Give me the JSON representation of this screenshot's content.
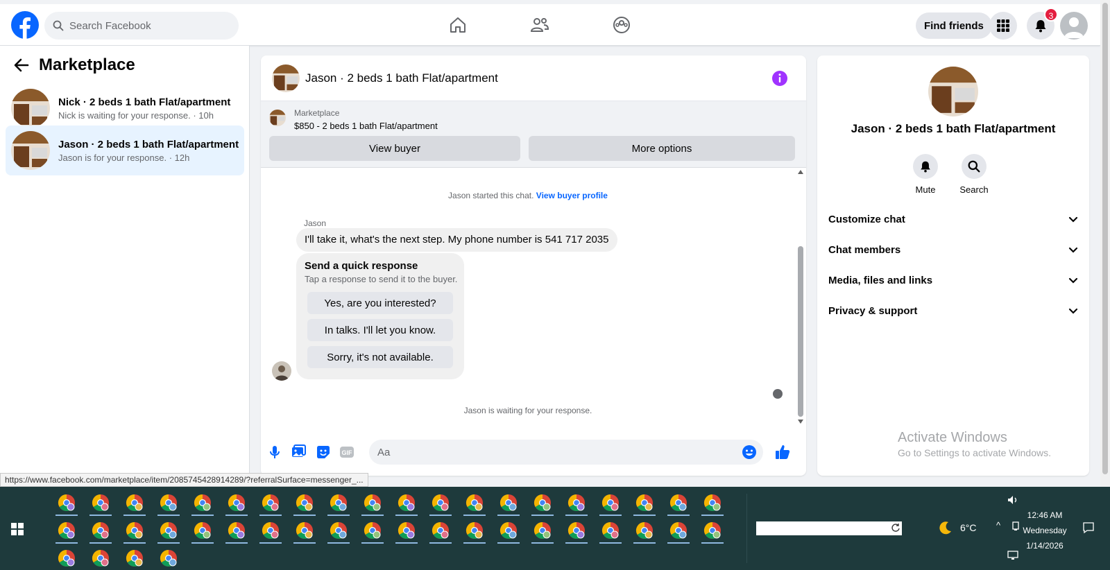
{
  "header": {
    "search_placeholder": "Search Facebook",
    "find_friends_label": "Find friends",
    "notification_count": "3",
    "brand_color": "#0866ff"
  },
  "sidebar": {
    "title": "Marketplace",
    "conversations": [
      {
        "title": "Nick · 2 beds 1 bath Flat/apartment",
        "subtitle": "Nick is waiting for your response. · 10h",
        "active": false
      },
      {
        "title": "Jason · 2 beds 1 bath Flat/apartment",
        "subtitle": "Jason is for your response. · 12h",
        "active": true
      }
    ]
  },
  "chat": {
    "title": "Jason · 2 beds 1 bath Flat/apartment",
    "listing_label": "Marketplace",
    "listing_price": "$850 - 2 beds 1 bath Flat/apartment",
    "view_buyer_label": "View buyer",
    "more_options_label": "More options",
    "started_text": "Jason started this chat.",
    "view_profile_link": "View buyer profile",
    "sender_name": "Jason",
    "message_text": "I'll take it, what's the next step. My phone number is 541 717 2035",
    "quick_title": "Send a quick response",
    "quick_subtitle": "Tap a response to send it to the buyer.",
    "quick_responses": [
      "Yes, are you interested?",
      "In talks. I'll let you know.",
      "Sorry, it's not available."
    ],
    "waiting_text": "Jason is waiting for your response.",
    "input_placeholder": "Aa"
  },
  "right_panel": {
    "title": "Jason · 2 beds 1 bath Flat/apartment",
    "actions": [
      "Mute",
      "Search"
    ],
    "sections": [
      "Customize chat",
      "Chat members",
      "Media, files and links",
      "Privacy & support"
    ]
  },
  "watermark": {
    "line1": "Activate Windows",
    "line2": "Go to Settings to activate Windows."
  },
  "status_url": "https://www.facebook.com/marketplace/item/2085745428914289/?referralSurface=messenger_...",
  "taskbar": {
    "weather_temp": "6°C",
    "time": "12:46 AM",
    "day": "Wednesday",
    "date": "1/14/2026"
  }
}
